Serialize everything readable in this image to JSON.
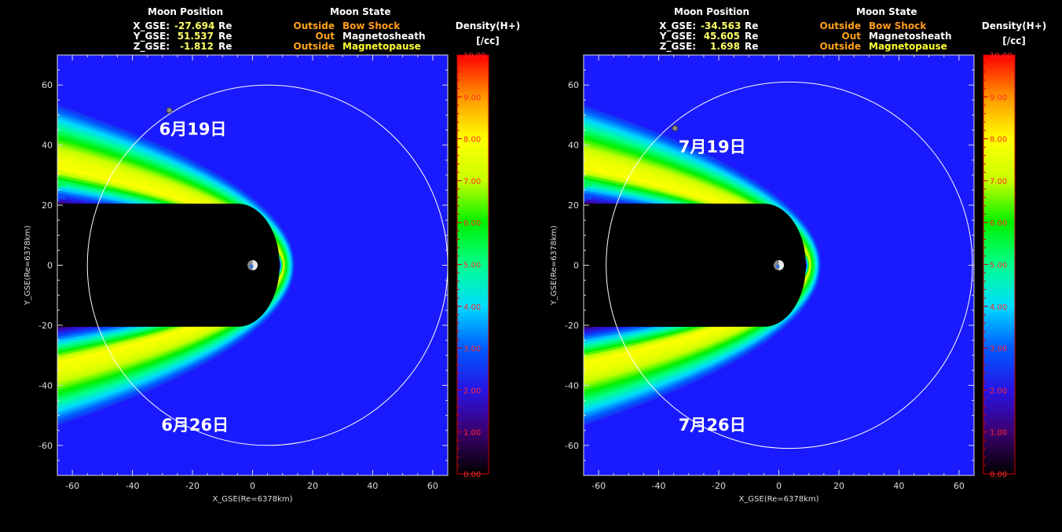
{
  "panels": [
    {
      "moon_position": {
        "title": "Moon Position",
        "rows": [
          {
            "label": "X_GSE:",
            "value": "-27.694",
            "unit": "Re"
          },
          {
            "label": "Y_GSE:",
            "value": "51.537",
            "unit": "Re"
          },
          {
            "label": "Z_GSE:",
            "value": "-1.812",
            "unit": "Re"
          }
        ]
      },
      "moon_state": {
        "title": "Moon State",
        "rows": [
          {
            "status": "Outside",
            "name": "Bow Shock",
            "name_color": "#ff9a1a"
          },
          {
            "status": "Out",
            "name": "Magnetosheath",
            "name_color": "#ffffff"
          },
          {
            "status": "Outside",
            "name": "Magnetopause",
            "name_color": "#ffff33"
          }
        ]
      },
      "colorbar": {
        "title": "Density(H+)",
        "unit": "[/cc]"
      },
      "dates": [
        {
          "text": "6月19日",
          "x": -27.7,
          "y": 51.5
        },
        {
          "text": "6月26日",
          "x": -27.0,
          "y": -47.0
        }
      ],
      "moon_marker": {
        "x": -27.694,
        "y": 51.537
      },
      "orbit": {
        "cx": 5.0,
        "cy": 0.0,
        "r": 60.0
      }
    },
    {
      "moon_position": {
        "title": "Moon Position",
        "rows": [
          {
            "label": "X_GSE:",
            "value": "-34.563",
            "unit": "Re"
          },
          {
            "label": "Y_GSE:",
            "value": "45.605",
            "unit": "Re"
          },
          {
            "label": "Z_GSE:",
            "value": "1.698",
            "unit": "Re"
          }
        ]
      },
      "moon_state": {
        "title": "Moon State",
        "rows": [
          {
            "status": "Outside",
            "name": "Bow Shock",
            "name_color": "#ff9a1a"
          },
          {
            "status": "Out",
            "name": "Magnetosheath",
            "name_color": "#ffffff"
          },
          {
            "status": "Outside",
            "name": "Magnetopause",
            "name_color": "#ffff33"
          }
        ]
      },
      "colorbar": {
        "title": "Density(H+)",
        "unit": "[/cc]"
      },
      "dates": [
        {
          "text": "7月19日",
          "x": -30.0,
          "y": 45.6
        },
        {
          "text": "7月26日",
          "x": -30.0,
          "y": -47.0
        }
      ],
      "moon_marker": {
        "x": -34.563,
        "y": 45.605
      },
      "orbit": {
        "cx": 3.5,
        "cy": 0.0,
        "r": 61.0
      }
    }
  ],
  "chart_data": {
    "type": "heatmap",
    "title": "",
    "xlabel": "X_GSE(Re=6378km)",
    "ylabel": "Y_GSE(Re=6378km)",
    "xlim": [
      -65,
      65
    ],
    "ylim": [
      -70,
      70
    ],
    "xticks": [
      -60,
      -40,
      -20,
      0,
      20,
      40,
      60
    ],
    "yticks": [
      -60,
      -40,
      -20,
      0,
      20,
      40,
      60
    ],
    "colorbar": {
      "label": "Density(H+)",
      "unit": "[/cc]",
      "range": [
        0,
        10
      ],
      "ticks": [
        "0.00",
        "1.00",
        "2.00",
        "3.00",
        "4.00",
        "5.00",
        "6.00",
        "7.00",
        "8.00",
        "9.00",
        "10.00"
      ]
    },
    "background_density": 2.3,
    "earth": {
      "x": 0,
      "y": 0
    },
    "bow_shock_nose_x": 14,
    "tail_half_width": 20.5,
    "colors": {
      "solar_wind": "#1a1aff",
      "magnetosphere": "#000000",
      "orbit_line": "#ffffff"
    }
  }
}
